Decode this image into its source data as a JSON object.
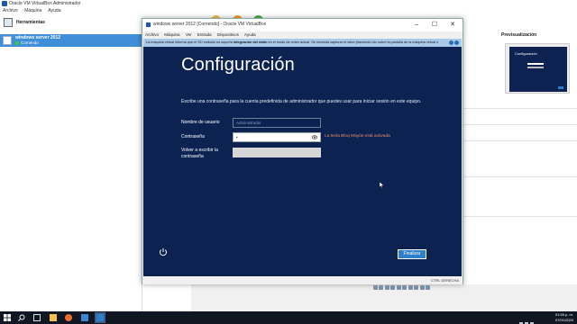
{
  "manager": {
    "title": "Oracle VM VirtualBox Administrador",
    "menu": [
      "Archivo",
      "Máquina",
      "Ayuda"
    ],
    "tools_label": "Herramientas",
    "vm_name": "windows server 2012",
    "vm_state": "Corriendo",
    "preview_label": "Previsualización"
  },
  "vm_window": {
    "title": "windows server 2012 [Corriendo] - Oracle VM VirtualBox",
    "menu": [
      "Archivo",
      "Máquina",
      "Ver",
      "Entrada",
      "Dispositivos",
      "Ayuda"
    ],
    "notice_pre": "La máquina virtual informa que el SO invitado no soporta ",
    "notice_bold": "integración del ratón",
    "notice_post": " en el modo de vídeo actual. Se necesita capturar el ratón (haciendo clic sobre la pantalla de la máquina virtual o",
    "host_key": "CTRL DERECHA"
  },
  "guest": {
    "title": "Configuración",
    "description": "Escribe una contraseña para la cuenta predefinida de administrador que puedes usar para iniciar sesión en este equipo.",
    "username_label": "Nombre de usuario",
    "username_placeholder": "Administrador",
    "password_label": "Contraseña",
    "password_value": "•",
    "confirm_label": "Volver a escribir la contraseña",
    "caps_warning": "La tecla Bloq Mayús está activada",
    "finish_label": "Finalizar"
  },
  "taskbar": {
    "time": "01:55 p. m.",
    "date": "07/01/2020"
  },
  "colors": {
    "guest_bg": "#0c2352",
    "accent": "#2f7fc8",
    "caps_warning": "#f28b6a",
    "selection": "#3f8fd8"
  }
}
